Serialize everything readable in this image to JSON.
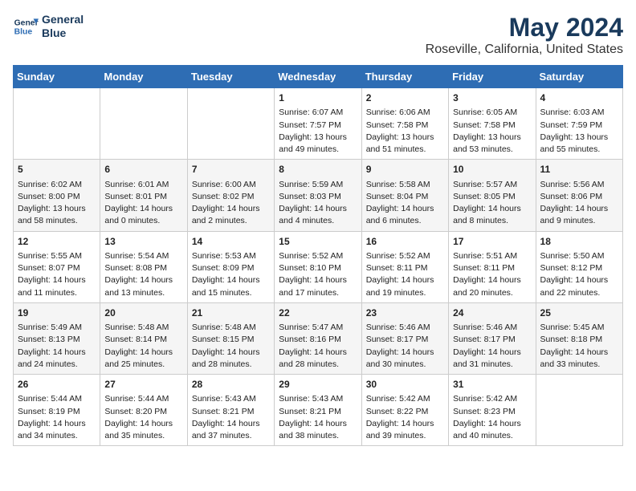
{
  "header": {
    "logo_line1": "General",
    "logo_line2": "Blue",
    "main_title": "May 2024",
    "subtitle": "Roseville, California, United States"
  },
  "weekdays": [
    "Sunday",
    "Monday",
    "Tuesday",
    "Wednesday",
    "Thursday",
    "Friday",
    "Saturday"
  ],
  "weeks": [
    [
      {
        "day": "",
        "content": ""
      },
      {
        "day": "",
        "content": ""
      },
      {
        "day": "",
        "content": ""
      },
      {
        "day": "1",
        "content": "Sunrise: 6:07 AM\nSunset: 7:57 PM\nDaylight: 13 hours\nand 49 minutes."
      },
      {
        "day": "2",
        "content": "Sunrise: 6:06 AM\nSunset: 7:58 PM\nDaylight: 13 hours\nand 51 minutes."
      },
      {
        "day": "3",
        "content": "Sunrise: 6:05 AM\nSunset: 7:58 PM\nDaylight: 13 hours\nand 53 minutes."
      },
      {
        "day": "4",
        "content": "Sunrise: 6:03 AM\nSunset: 7:59 PM\nDaylight: 13 hours\nand 55 minutes."
      }
    ],
    [
      {
        "day": "5",
        "content": "Sunrise: 6:02 AM\nSunset: 8:00 PM\nDaylight: 13 hours\nand 58 minutes."
      },
      {
        "day": "6",
        "content": "Sunrise: 6:01 AM\nSunset: 8:01 PM\nDaylight: 14 hours\nand 0 minutes."
      },
      {
        "day": "7",
        "content": "Sunrise: 6:00 AM\nSunset: 8:02 PM\nDaylight: 14 hours\nand 2 minutes."
      },
      {
        "day": "8",
        "content": "Sunrise: 5:59 AM\nSunset: 8:03 PM\nDaylight: 14 hours\nand 4 minutes."
      },
      {
        "day": "9",
        "content": "Sunrise: 5:58 AM\nSunset: 8:04 PM\nDaylight: 14 hours\nand 6 minutes."
      },
      {
        "day": "10",
        "content": "Sunrise: 5:57 AM\nSunset: 8:05 PM\nDaylight: 14 hours\nand 8 minutes."
      },
      {
        "day": "11",
        "content": "Sunrise: 5:56 AM\nSunset: 8:06 PM\nDaylight: 14 hours\nand 9 minutes."
      }
    ],
    [
      {
        "day": "12",
        "content": "Sunrise: 5:55 AM\nSunset: 8:07 PM\nDaylight: 14 hours\nand 11 minutes."
      },
      {
        "day": "13",
        "content": "Sunrise: 5:54 AM\nSunset: 8:08 PM\nDaylight: 14 hours\nand 13 minutes."
      },
      {
        "day": "14",
        "content": "Sunrise: 5:53 AM\nSunset: 8:09 PM\nDaylight: 14 hours\nand 15 minutes."
      },
      {
        "day": "15",
        "content": "Sunrise: 5:52 AM\nSunset: 8:10 PM\nDaylight: 14 hours\nand 17 minutes."
      },
      {
        "day": "16",
        "content": "Sunrise: 5:52 AM\nSunset: 8:11 PM\nDaylight: 14 hours\nand 19 minutes."
      },
      {
        "day": "17",
        "content": "Sunrise: 5:51 AM\nSunset: 8:11 PM\nDaylight: 14 hours\nand 20 minutes."
      },
      {
        "day": "18",
        "content": "Sunrise: 5:50 AM\nSunset: 8:12 PM\nDaylight: 14 hours\nand 22 minutes."
      }
    ],
    [
      {
        "day": "19",
        "content": "Sunrise: 5:49 AM\nSunset: 8:13 PM\nDaylight: 14 hours\nand 24 minutes."
      },
      {
        "day": "20",
        "content": "Sunrise: 5:48 AM\nSunset: 8:14 PM\nDaylight: 14 hours\nand 25 minutes."
      },
      {
        "day": "21",
        "content": "Sunrise: 5:48 AM\nSunset: 8:15 PM\nDaylight: 14 hours\nand 28 minutes."
      },
      {
        "day": "22",
        "content": "Sunrise: 5:47 AM\nSunset: 8:16 PM\nDaylight: 14 hours\nand 28 minutes."
      },
      {
        "day": "23",
        "content": "Sunrise: 5:46 AM\nSunset: 8:17 PM\nDaylight: 14 hours\nand 30 minutes."
      },
      {
        "day": "24",
        "content": "Sunrise: 5:46 AM\nSunset: 8:17 PM\nDaylight: 14 hours\nand 31 minutes."
      },
      {
        "day": "25",
        "content": "Sunrise: 5:45 AM\nSunset: 8:18 PM\nDaylight: 14 hours\nand 33 minutes."
      }
    ],
    [
      {
        "day": "26",
        "content": "Sunrise: 5:44 AM\nSunset: 8:19 PM\nDaylight: 14 hours\nand 34 minutes."
      },
      {
        "day": "27",
        "content": "Sunrise: 5:44 AM\nSunset: 8:20 PM\nDaylight: 14 hours\nand 35 minutes."
      },
      {
        "day": "28",
        "content": "Sunrise: 5:43 AM\nSunset: 8:21 PM\nDaylight: 14 hours\nand 37 minutes."
      },
      {
        "day": "29",
        "content": "Sunrise: 5:43 AM\nSunset: 8:21 PM\nDaylight: 14 hours\nand 38 minutes."
      },
      {
        "day": "30",
        "content": "Sunrise: 5:42 AM\nSunset: 8:22 PM\nDaylight: 14 hours\nand 39 minutes."
      },
      {
        "day": "31",
        "content": "Sunrise: 5:42 AM\nSunset: 8:23 PM\nDaylight: 14 hours\nand 40 minutes."
      },
      {
        "day": "",
        "content": ""
      }
    ]
  ]
}
